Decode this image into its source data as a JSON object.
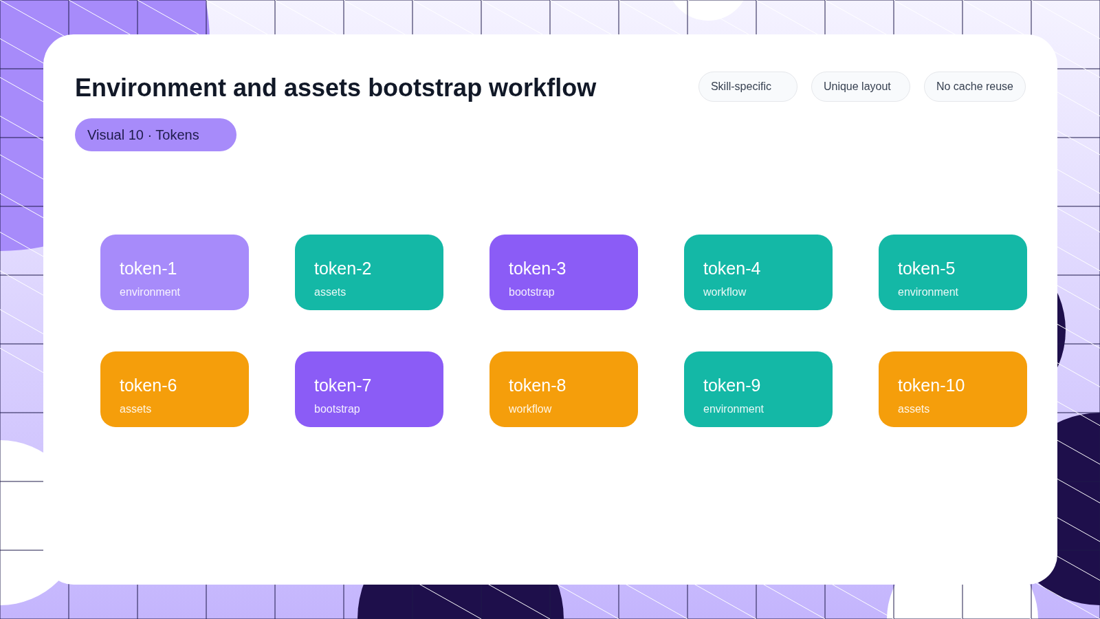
{
  "title": "Environment and assets bootstrap workflow",
  "badge": "Visual 10 · Tokens",
  "chips": [
    "Skill-specific",
    "Unique layout",
    "No cache reuse"
  ],
  "tokens": [
    {
      "label": "token-1",
      "tag": "environment",
      "color": "#a78bfa"
    },
    {
      "label": "token-2",
      "tag": "assets",
      "color": "#14b8a6"
    },
    {
      "label": "token-3",
      "tag": "bootstrap",
      "color": "#8b5cf6"
    },
    {
      "label": "token-4",
      "tag": "workflow",
      "color": "#14b8a6"
    },
    {
      "label": "token-5",
      "tag": "environment",
      "color": "#14b8a6"
    },
    {
      "label": "token-6",
      "tag": "assets",
      "color": "#f59e0b"
    },
    {
      "label": "token-7",
      "tag": "bootstrap",
      "color": "#8b5cf6"
    },
    {
      "label": "token-8",
      "tag": "workflow",
      "color": "#f59e0b"
    },
    {
      "label": "token-9",
      "tag": "environment",
      "color": "#14b8a6"
    },
    {
      "label": "token-10",
      "tag": "assets",
      "color": "#f59e0b"
    }
  ]
}
